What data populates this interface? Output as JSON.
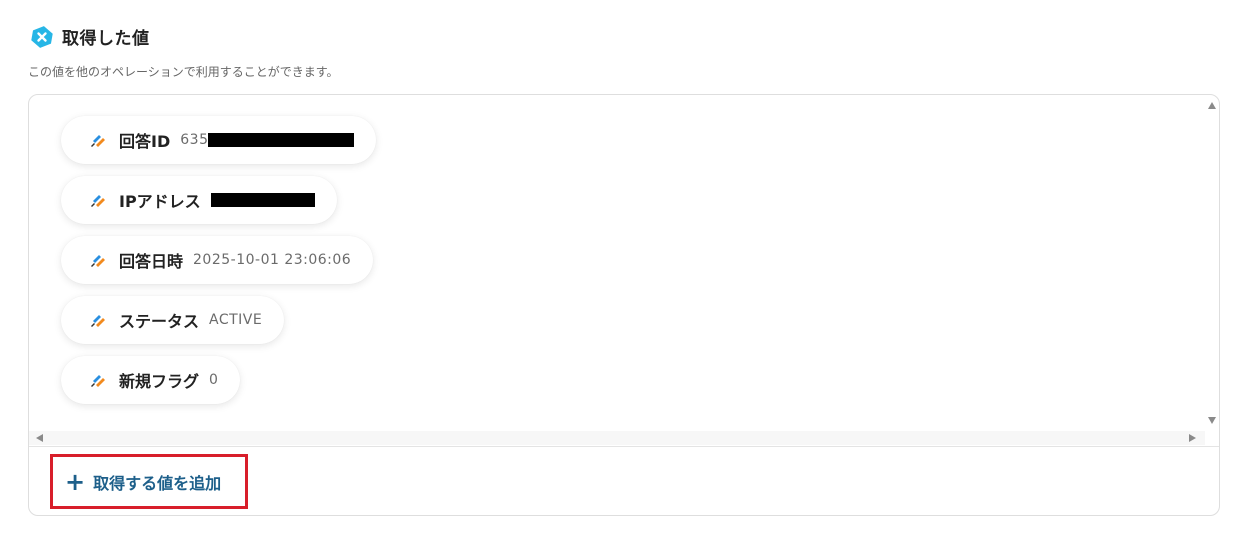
{
  "header": {
    "title": "取得した値",
    "subtitle": "この値を他のオペレーションで利用することができます。"
  },
  "fields": [
    {
      "label": "回答ID",
      "value_prefix": "635",
      "redacted": true
    },
    {
      "label": "IPアドレス",
      "value_prefix": "",
      "redacted": true
    },
    {
      "label": "回答日時",
      "value": "2025-10-01 23:06:06"
    },
    {
      "label": "ステータス",
      "value": "ACTIVE"
    },
    {
      "label": "新規フラグ",
      "value": "0"
    }
  ],
  "actions": {
    "add_label": "取得する値を追加"
  },
  "colors": {
    "accent": "#1d5f8a",
    "highlight_border": "#d81e2a",
    "header_icon": "#27b6e6"
  },
  "icons": {
    "header": "x-badge-icon",
    "field": "form-app-icon"
  }
}
